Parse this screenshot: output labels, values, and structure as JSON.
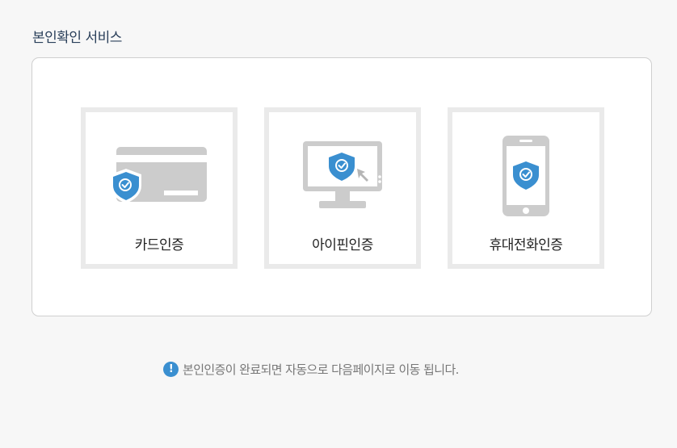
{
  "section_title": "본인확인 서비스",
  "colors": {
    "accent": "#3a8fd0",
    "icon_gray": "#cccccc",
    "card_border": "#eaeaea"
  },
  "methods": [
    {
      "label": "카드인증",
      "icon": "card-shield-icon"
    },
    {
      "label": "아이핀인증",
      "icon": "monitor-shield-icon"
    },
    {
      "label": "휴대전화인증",
      "icon": "phone-shield-icon"
    }
  ],
  "notice": {
    "icon": "exclamation-icon",
    "icon_text": "!",
    "text": "본인인증이 완료되면 자동으로 다음페이지로 이동 됩니다."
  }
}
